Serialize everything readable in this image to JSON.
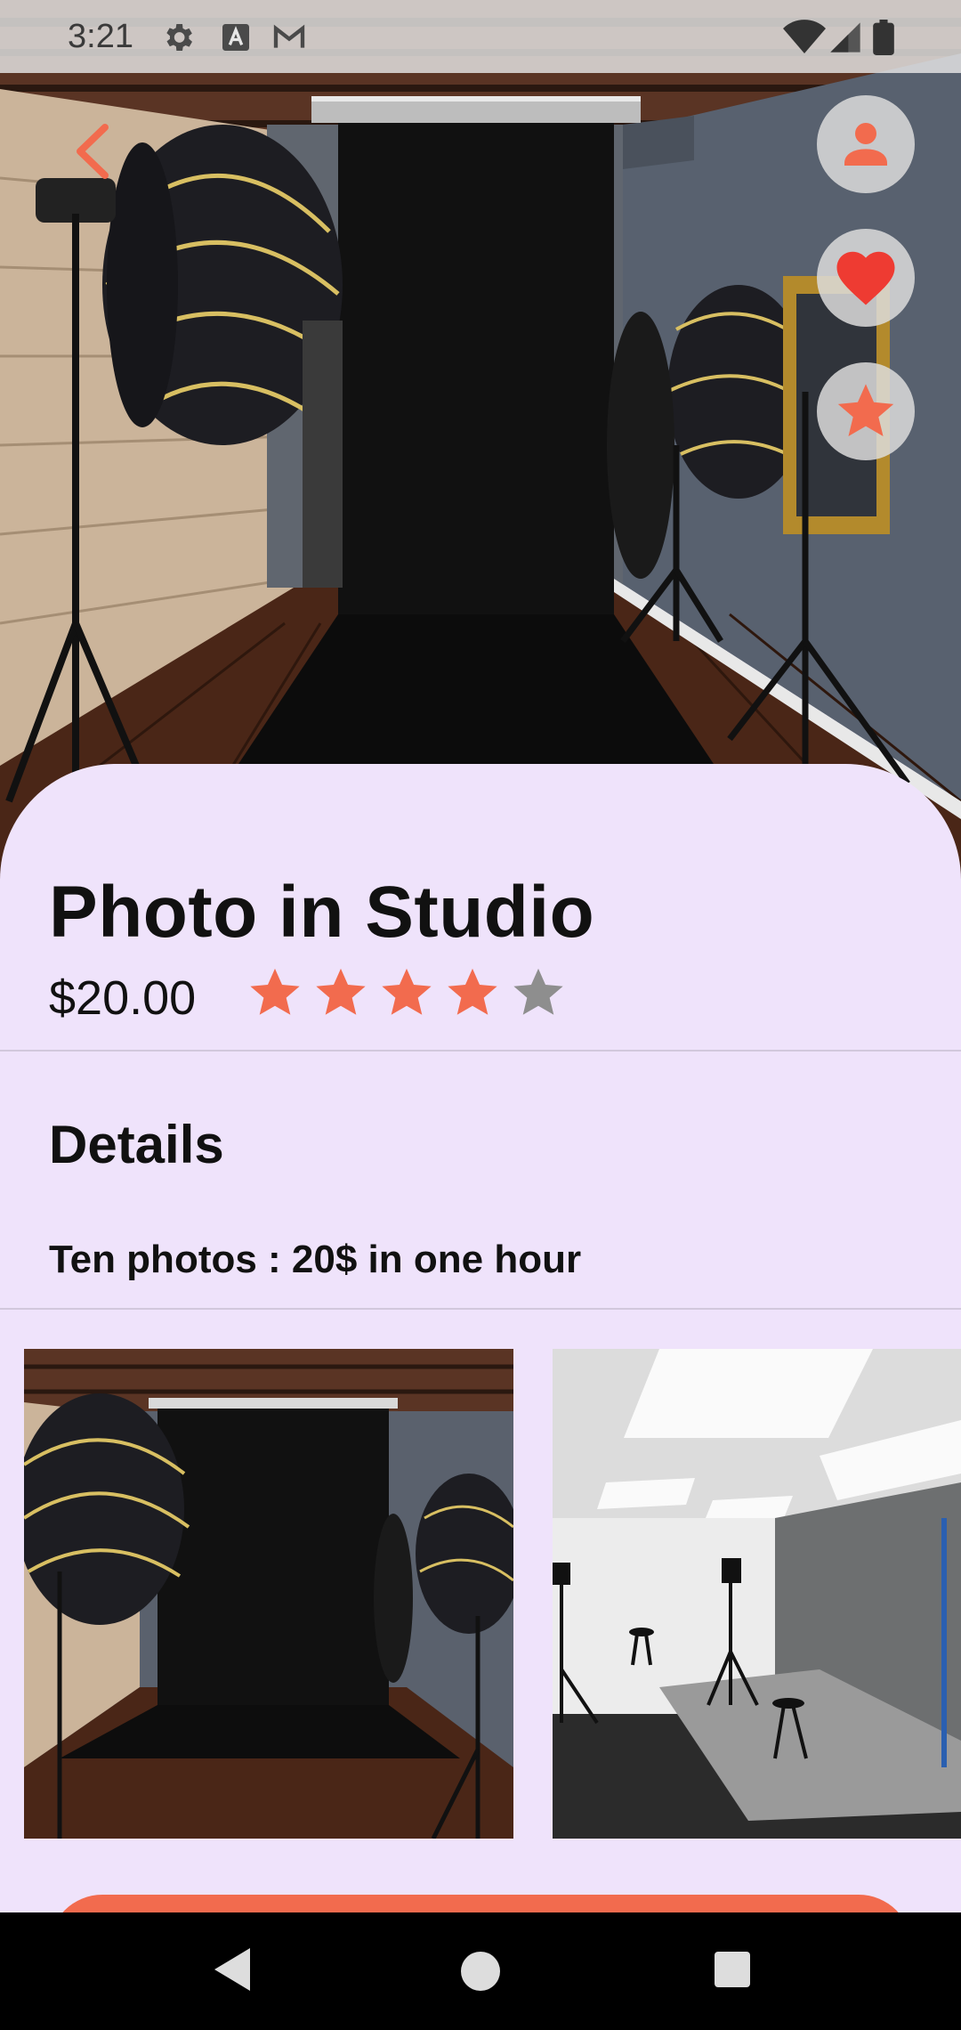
{
  "status_bar": {
    "time": "3:21",
    "left_icons": [
      "settings-icon",
      "font-a-icon",
      "gmail-icon"
    ],
    "right_icons": [
      "wifi-icon",
      "cellular-signal-icon",
      "battery-icon"
    ]
  },
  "top_actions": {
    "back_icon": "chevron-left-icon",
    "profile_icon": "person-icon",
    "favorite_icon": "heart-icon",
    "rate_icon": "star-icon"
  },
  "listing": {
    "title": "Photo in Studio",
    "price": "$20.00",
    "rating": 4,
    "rating_max": 5
  },
  "details": {
    "heading": "Details",
    "text": "Ten photos : 20$ in one hour"
  },
  "gallery": {
    "images": [
      "studio-black-backdrop-photo",
      "studio-white-gray-backdrop-photo"
    ]
  },
  "navigation": {
    "buttons": [
      "back-triangle-icon",
      "home-circle-icon",
      "recents-square-icon"
    ]
  },
  "colors": {
    "accent": "#F26B4E",
    "sheet_background": "#EFE3FB",
    "star_filled": "#F26B4E",
    "star_empty": "#8E8E8E",
    "favorite_heart": "#EE3B32"
  }
}
